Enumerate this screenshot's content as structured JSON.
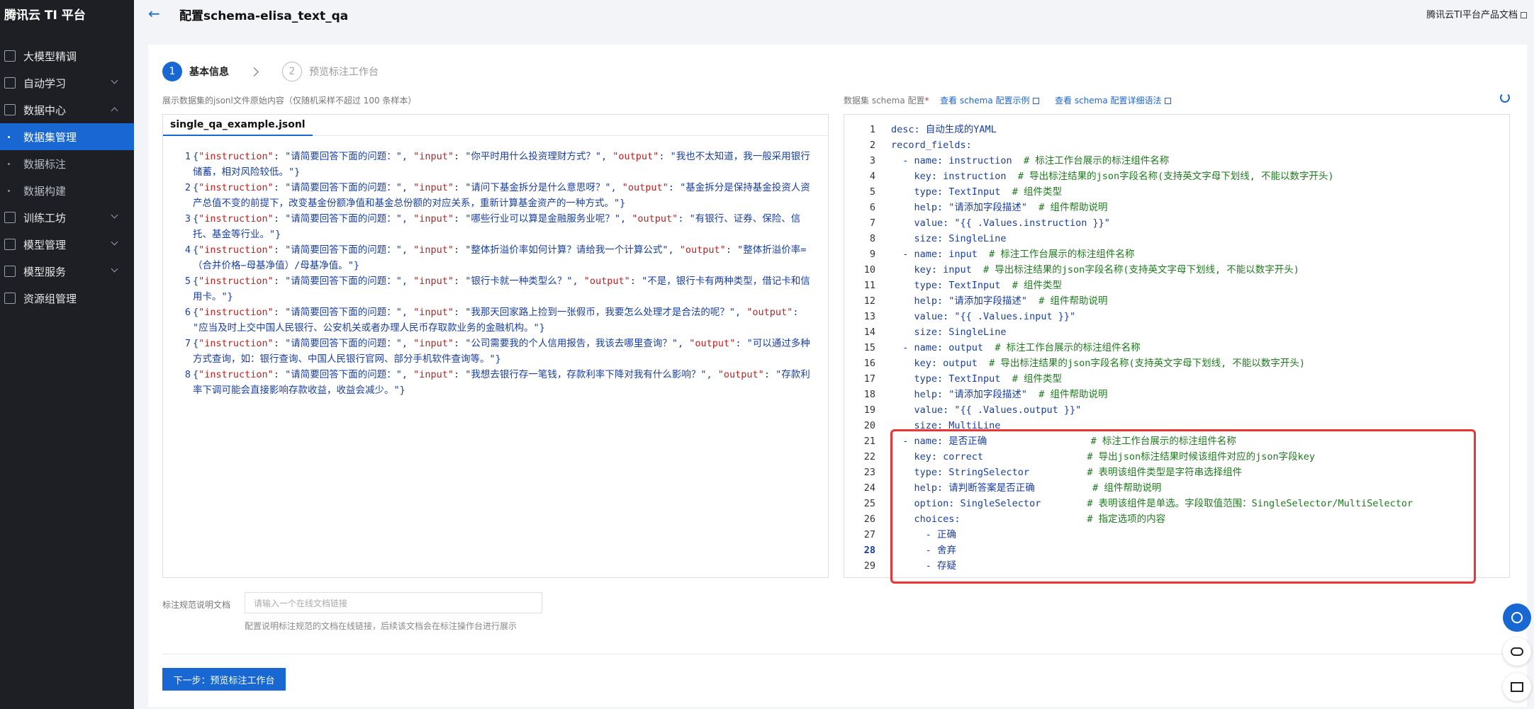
{
  "brand": "腾讯云 TI 平台",
  "sidebar": {
    "items": [
      {
        "label": "大模型精调"
      },
      {
        "label": "自动学习"
      },
      {
        "label": "数据中心"
      },
      {
        "label": "数据集管理"
      },
      {
        "label": "数据标注"
      },
      {
        "label": "数据构建"
      },
      {
        "label": "训练工坊"
      },
      {
        "label": "模型管理"
      },
      {
        "label": "模型服务"
      },
      {
        "label": "资源组管理"
      }
    ]
  },
  "header": {
    "title": "配置schema-elisa_text_qa",
    "doc_link": "腾讯云TI平台产品文档"
  },
  "steps": [
    {
      "num": "1",
      "label": "基本信息"
    },
    {
      "num": "2",
      "label": "预览标注工作台"
    }
  ],
  "left": {
    "desc": "展示数据集的jsonl文件原始内容（仅随机采样不超过 100 条样本）",
    "file_tab": "single_qa_example.jsonl",
    "lines": [
      {
        "num": "1",
        "instruction": "请简要回答下面的问题：",
        "input": "你平时用什么投资理财方式？",
        "output": "我也不太知道，我一般采用银行储蓄，相对风险较低。"
      },
      {
        "num": "2",
        "instruction": "请简要回答下面的问题：",
        "input": "请问下基金拆分是什么意思呀？",
        "output": "基金拆分是保持基金投资人资产总值不变的前提下，改变基金份额净值和基金总份额的对应关系，重新计算基金资产的一种方式。"
      },
      {
        "num": "3",
        "instruction": "请简要回答下面的问题：",
        "input": "哪些行业可以算是金融服务业呢？",
        "output": "有银行、证券、保险、信托、基金等行业。"
      },
      {
        "num": "4",
        "instruction": "请简要回答下面的问题：",
        "input": "整体折溢价率如何计算？请给我一个计算公式",
        "output": "整体折溢价率=（合并价格−母基净值）/母基净值。"
      },
      {
        "num": "5",
        "instruction": "请简要回答下面的问题：",
        "input": "银行卡就一种类型么？",
        "output": "不是，银行卡有两种类型，借记卡和信用卡。"
      },
      {
        "num": "6",
        "instruction": "请简要回答下面的问题：",
        "input": "我那天回家路上捡到一张假币，我要怎么处理才是合法的呢？",
        "output": "应当及时上交中国人民银行、公安机关或者办理人民币存取款业务的金融机构。"
      },
      {
        "num": "7",
        "instruction": "请简要回答下面的问题：",
        "input": "公司需要我的个人信用报告，我该去哪里查询？",
        "output": "可以通过多种方式查询，如：银行查询、中国人民银行官网、部分手机软件查询等。"
      },
      {
        "num": "8",
        "instruction": "请简要回答下面的问题：",
        "input": "我想去银行存一笔钱，存款利率下降对我有什么影响？",
        "output": "存款利率下调可能会直接影响存款收益，收益会减少。"
      }
    ]
  },
  "right": {
    "label": "数据集 schema 配置",
    "required_mark": "*",
    "link1": "查看 schema 配置示例",
    "link2": "查看 schema 配置详细语法",
    "yaml": [
      {
        "n": "1",
        "code": "desc: 自动生成的YAML",
        "c": ""
      },
      {
        "n": "2",
        "code": "record_fields:",
        "c": ""
      },
      {
        "n": "3",
        "code": "  - name: instruction  ",
        "c": "# 标注工作台展示的标注组件名称"
      },
      {
        "n": "4",
        "code": "    key: instruction  ",
        "c": "# 导出标注结果的json字段名称(支持英文字母下划线, 不能以数字开头)"
      },
      {
        "n": "5",
        "code": "    type: TextInput  ",
        "c": "# 组件类型"
      },
      {
        "n": "6",
        "code": "    help: \"请添加字段描述\"  ",
        "c": "# 组件帮助说明"
      },
      {
        "n": "7",
        "code": "    value: \"{{ .Values.instruction }}\"",
        "c": ""
      },
      {
        "n": "8",
        "code": "    size: SingleLine",
        "c": ""
      },
      {
        "n": "9",
        "code": "  - name: input  ",
        "c": "# 标注工作台展示的标注组件名称"
      },
      {
        "n": "10",
        "code": "    key: input  ",
        "c": "# 导出标注结果的json字段名称(支持英文字母下划线, 不能以数字开头)"
      },
      {
        "n": "11",
        "code": "    type: TextInput  ",
        "c": "# 组件类型"
      },
      {
        "n": "12",
        "code": "    help: \"请添加字段描述\"  ",
        "c": "# 组件帮助说明"
      },
      {
        "n": "13",
        "code": "    value: \"{{ .Values.input }}\"",
        "c": ""
      },
      {
        "n": "14",
        "code": "    size: SingleLine",
        "c": ""
      },
      {
        "n": "15",
        "code": "  - name: output  ",
        "c": "# 标注工作台展示的标注组件名称"
      },
      {
        "n": "16",
        "code": "    key: output  ",
        "c": "# 导出标注结果的json字段名称(支持英文字母下划线, 不能以数字开头)"
      },
      {
        "n": "17",
        "code": "    type: TextInput  ",
        "c": "# 组件类型"
      },
      {
        "n": "18",
        "code": "    help: \"请添加字段描述\"  ",
        "c": "# 组件帮助说明"
      },
      {
        "n": "19",
        "code": "    value: \"{{ .Values.output }}\"",
        "c": ""
      },
      {
        "n": "20",
        "code": "    size: MultiLine",
        "c": ""
      },
      {
        "n": "21",
        "code": "  - name: 是否正确                  ",
        "c": "# 标注工作台展示的标注组件名称"
      },
      {
        "n": "22",
        "code": "    key: correct                  ",
        "c": "# 导出json标注结果时候该组件对应的json字段key"
      },
      {
        "n": "23",
        "code": "    type: StringSelector          ",
        "c": "# 表明该组件类型是字符串选择组件"
      },
      {
        "n": "24",
        "code": "    help: 请判断答案是否正确          ",
        "c": "# 组件帮助说明"
      },
      {
        "n": "25",
        "code": "    option: SingleSelector        ",
        "c": "# 表明该组件是单选。字段取值范围：SingleSelector/MultiSelector"
      },
      {
        "n": "26",
        "code": "    choices:                      ",
        "c": "# 指定选项的内容"
      },
      {
        "n": "27",
        "code": "      - 正确",
        "c": ""
      },
      {
        "n": "28",
        "code": "      - 舍弃",
        "c": ""
      },
      {
        "n": "29",
        "code": "      - 存疑",
        "c": ""
      }
    ]
  },
  "doc": {
    "label": "标注规范说明文档",
    "placeholder": "请输入一个在线文档链接",
    "hint": "配置说明标注规范的文档在线链接，后续该文档会在标注操作台进行展示"
  },
  "next_button": "下一步：预览标注工作台",
  "colors": {
    "accent": "#1967d2",
    "sidebar": "#1d1f24",
    "highlight": "#ee3333"
  }
}
